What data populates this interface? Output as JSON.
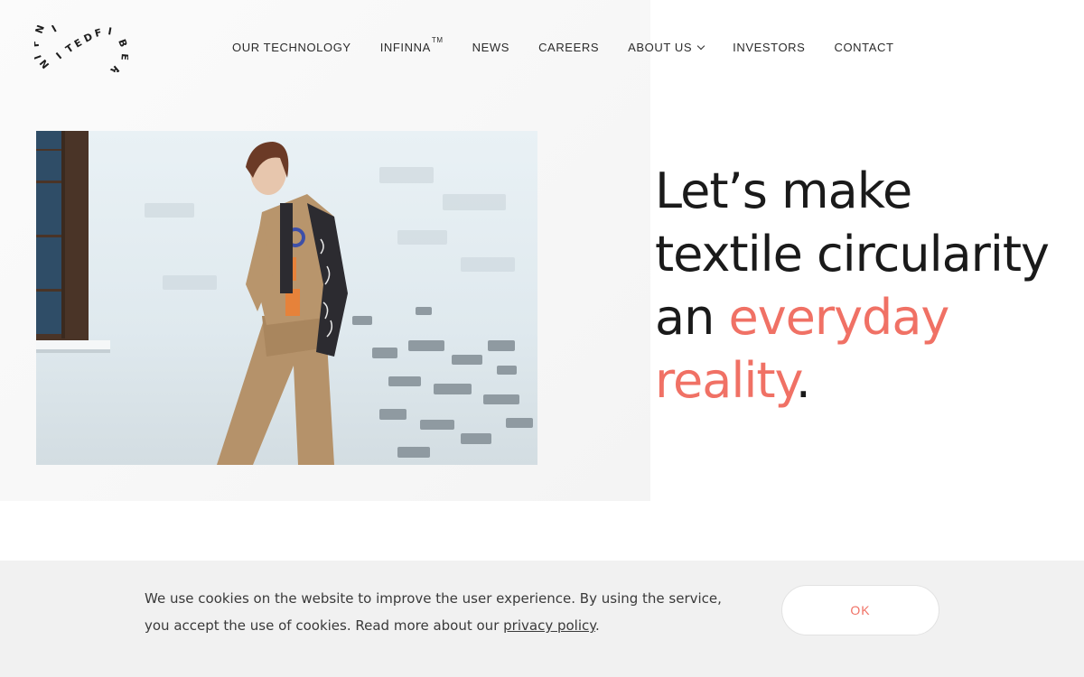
{
  "logo": {
    "letters": [
      "N",
      "I",
      "F",
      "I",
      "N",
      "I",
      "T",
      "E",
      "D",
      "F",
      "I",
      "B",
      "E",
      "R"
    ],
    "alt": "INFINITEDFIBER"
  },
  "nav": {
    "items": [
      {
        "label": "OUR TECHNOLOGY"
      },
      {
        "label": "INFINNA",
        "sup": "TM"
      },
      {
        "label": "NEWS"
      },
      {
        "label": "CAREERS"
      },
      {
        "label": "ABOUT US",
        "dropdown": true
      },
      {
        "label": "INVESTORS"
      },
      {
        "label": "CONTACT"
      }
    ]
  },
  "hero": {
    "headline_line1": "Let’s make",
    "headline_line2": "textile circularity",
    "headline_an": "an ",
    "headline_accent1": "everyday",
    "headline_accent2": "reality",
    "headline_period": ".",
    "accent_color": "#f07165"
  },
  "cookie": {
    "text": "We use cookies on the website to improve the user experience. By using the service, you accept the use of cookies. Read more about our ",
    "link_text": "privacy policy",
    "after_link": ".",
    "ok_label": "OK"
  }
}
